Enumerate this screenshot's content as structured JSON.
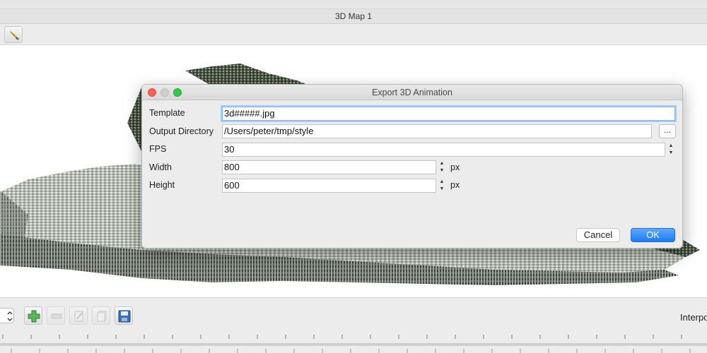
{
  "window": {
    "title": "3D Map 1"
  },
  "dialog": {
    "title": "Export 3D Animation",
    "fields": {
      "template": {
        "label": "Template",
        "value": "3d#####.jpg"
      },
      "output_directory": {
        "label": "Output Directory",
        "value": "/Users/peter/tmp/style",
        "browse_label": "..."
      },
      "fps": {
        "label": "FPS",
        "value": "30"
      },
      "width": {
        "label": "Width",
        "value": "800",
        "unit": "px"
      },
      "height": {
        "label": "Height",
        "value": "600",
        "unit": "px"
      }
    },
    "buttons": {
      "cancel": "Cancel",
      "ok": "OK"
    }
  },
  "anim_panel": {
    "interpolation_label": "Interpo"
  },
  "colors": {
    "accent": "#1a7cf5",
    "close": "#fc5f57",
    "maximize": "#34c748"
  }
}
